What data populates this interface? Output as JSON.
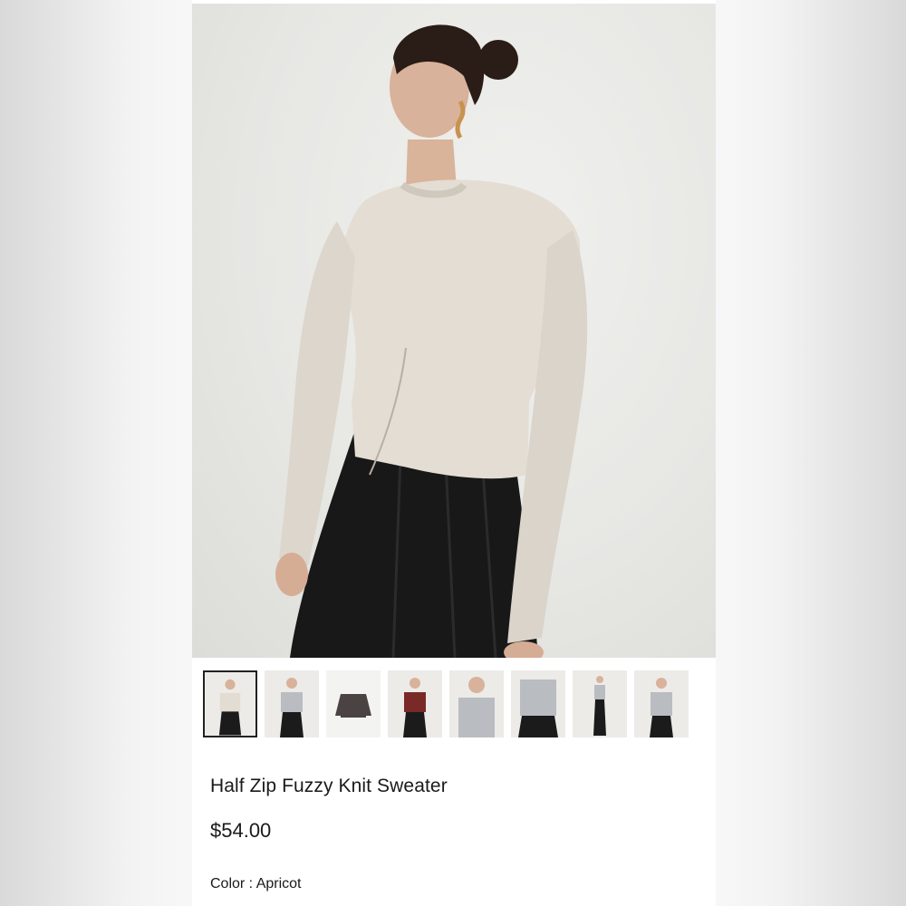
{
  "product": {
    "title": "Half Zip Fuzzy Knit Sweater",
    "price": "$54.00",
    "color_label": "Color : Apricot"
  },
  "gallery": {
    "selected_index": 0,
    "thumbnails": [
      {
        "name": "thumb-apricot-front",
        "sweater": "#e2dcd3",
        "bottom": "#1b1b1b"
      },
      {
        "name": "thumb-grey-front",
        "sweater": "#b9bcc0",
        "bottom": "#1b1b1b"
      },
      {
        "name": "thumb-charcoal-flat",
        "sweater": "#4a4342",
        "bottom": "none"
      },
      {
        "name": "thumb-burgundy-front",
        "sweater": "#7a2a26",
        "bottom": "#1b1b1b"
      },
      {
        "name": "thumb-grey-closeup",
        "sweater": "#b9bcc0",
        "bottom": "none"
      },
      {
        "name": "thumb-grey-detail",
        "sweater": "#b9bcc0",
        "bottom": "#1b1b1b"
      },
      {
        "name": "thumb-grey-fullbody",
        "sweater": "#b9bcc0",
        "bottom": "#1b1b1b"
      },
      {
        "name": "thumb-grey-side",
        "sweater": "#b9bcc0",
        "bottom": "#1b1b1b"
      }
    ]
  },
  "colors": {
    "selected_border": "#222222"
  }
}
